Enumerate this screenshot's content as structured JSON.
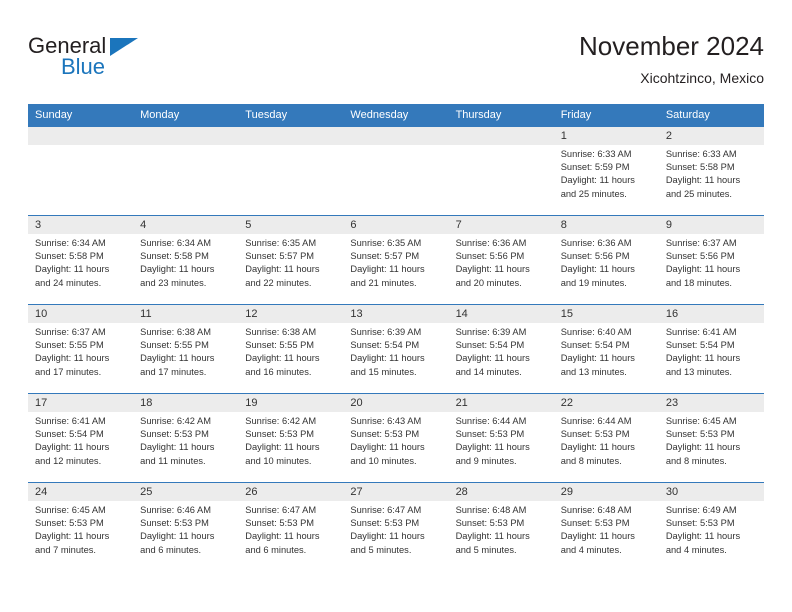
{
  "logo": {
    "word1": "General",
    "word2": "Blue",
    "triangle_icon": "blue-triangle-icon",
    "color_dark": "#231f20",
    "color_blue": "#1b75bc"
  },
  "header": {
    "title": "November 2024",
    "subtitle": "Xicohtzinco, Mexico"
  },
  "theme": {
    "header_bg": "#3479bb",
    "daynum_bg": "#ececec",
    "text": "#333333"
  },
  "calendar": {
    "weekday_headers": [
      "Sunday",
      "Monday",
      "Tuesday",
      "Wednesday",
      "Thursday",
      "Friday",
      "Saturday"
    ],
    "weeks": [
      [
        {
          "day": "",
          "sunrise": "",
          "sunset": "",
          "daylight": ""
        },
        {
          "day": "",
          "sunrise": "",
          "sunset": "",
          "daylight": ""
        },
        {
          "day": "",
          "sunrise": "",
          "sunset": "",
          "daylight": ""
        },
        {
          "day": "",
          "sunrise": "",
          "sunset": "",
          "daylight": ""
        },
        {
          "day": "",
          "sunrise": "",
          "sunset": "",
          "daylight": ""
        },
        {
          "day": "1",
          "sunrise": "Sunrise: 6:33 AM",
          "sunset": "Sunset: 5:59 PM",
          "daylight": "Daylight: 11 hours and 25 minutes."
        },
        {
          "day": "2",
          "sunrise": "Sunrise: 6:33 AM",
          "sunset": "Sunset: 5:58 PM",
          "daylight": "Daylight: 11 hours and 25 minutes."
        }
      ],
      [
        {
          "day": "3",
          "sunrise": "Sunrise: 6:34 AM",
          "sunset": "Sunset: 5:58 PM",
          "daylight": "Daylight: 11 hours and 24 minutes."
        },
        {
          "day": "4",
          "sunrise": "Sunrise: 6:34 AM",
          "sunset": "Sunset: 5:58 PM",
          "daylight": "Daylight: 11 hours and 23 minutes."
        },
        {
          "day": "5",
          "sunrise": "Sunrise: 6:35 AM",
          "sunset": "Sunset: 5:57 PM",
          "daylight": "Daylight: 11 hours and 22 minutes."
        },
        {
          "day": "6",
          "sunrise": "Sunrise: 6:35 AM",
          "sunset": "Sunset: 5:57 PM",
          "daylight": "Daylight: 11 hours and 21 minutes."
        },
        {
          "day": "7",
          "sunrise": "Sunrise: 6:36 AM",
          "sunset": "Sunset: 5:56 PM",
          "daylight": "Daylight: 11 hours and 20 minutes."
        },
        {
          "day": "8",
          "sunrise": "Sunrise: 6:36 AM",
          "sunset": "Sunset: 5:56 PM",
          "daylight": "Daylight: 11 hours and 19 minutes."
        },
        {
          "day": "9",
          "sunrise": "Sunrise: 6:37 AM",
          "sunset": "Sunset: 5:56 PM",
          "daylight": "Daylight: 11 hours and 18 minutes."
        }
      ],
      [
        {
          "day": "10",
          "sunrise": "Sunrise: 6:37 AM",
          "sunset": "Sunset: 5:55 PM",
          "daylight": "Daylight: 11 hours and 17 minutes."
        },
        {
          "day": "11",
          "sunrise": "Sunrise: 6:38 AM",
          "sunset": "Sunset: 5:55 PM",
          "daylight": "Daylight: 11 hours and 17 minutes."
        },
        {
          "day": "12",
          "sunrise": "Sunrise: 6:38 AM",
          "sunset": "Sunset: 5:55 PM",
          "daylight": "Daylight: 11 hours and 16 minutes."
        },
        {
          "day": "13",
          "sunrise": "Sunrise: 6:39 AM",
          "sunset": "Sunset: 5:54 PM",
          "daylight": "Daylight: 11 hours and 15 minutes."
        },
        {
          "day": "14",
          "sunrise": "Sunrise: 6:39 AM",
          "sunset": "Sunset: 5:54 PM",
          "daylight": "Daylight: 11 hours and 14 minutes."
        },
        {
          "day": "15",
          "sunrise": "Sunrise: 6:40 AM",
          "sunset": "Sunset: 5:54 PM",
          "daylight": "Daylight: 11 hours and 13 minutes."
        },
        {
          "day": "16",
          "sunrise": "Sunrise: 6:41 AM",
          "sunset": "Sunset: 5:54 PM",
          "daylight": "Daylight: 11 hours and 13 minutes."
        }
      ],
      [
        {
          "day": "17",
          "sunrise": "Sunrise: 6:41 AM",
          "sunset": "Sunset: 5:54 PM",
          "daylight": "Daylight: 11 hours and 12 minutes."
        },
        {
          "day": "18",
          "sunrise": "Sunrise: 6:42 AM",
          "sunset": "Sunset: 5:53 PM",
          "daylight": "Daylight: 11 hours and 11 minutes."
        },
        {
          "day": "19",
          "sunrise": "Sunrise: 6:42 AM",
          "sunset": "Sunset: 5:53 PM",
          "daylight": "Daylight: 11 hours and 10 minutes."
        },
        {
          "day": "20",
          "sunrise": "Sunrise: 6:43 AM",
          "sunset": "Sunset: 5:53 PM",
          "daylight": "Daylight: 11 hours and 10 minutes."
        },
        {
          "day": "21",
          "sunrise": "Sunrise: 6:44 AM",
          "sunset": "Sunset: 5:53 PM",
          "daylight": "Daylight: 11 hours and 9 minutes."
        },
        {
          "day": "22",
          "sunrise": "Sunrise: 6:44 AM",
          "sunset": "Sunset: 5:53 PM",
          "daylight": "Daylight: 11 hours and 8 minutes."
        },
        {
          "day": "23",
          "sunrise": "Sunrise: 6:45 AM",
          "sunset": "Sunset: 5:53 PM",
          "daylight": "Daylight: 11 hours and 8 minutes."
        }
      ],
      [
        {
          "day": "24",
          "sunrise": "Sunrise: 6:45 AM",
          "sunset": "Sunset: 5:53 PM",
          "daylight": "Daylight: 11 hours and 7 minutes."
        },
        {
          "day": "25",
          "sunrise": "Sunrise: 6:46 AM",
          "sunset": "Sunset: 5:53 PM",
          "daylight": "Daylight: 11 hours and 6 minutes."
        },
        {
          "day": "26",
          "sunrise": "Sunrise: 6:47 AM",
          "sunset": "Sunset: 5:53 PM",
          "daylight": "Daylight: 11 hours and 6 minutes."
        },
        {
          "day": "27",
          "sunrise": "Sunrise: 6:47 AM",
          "sunset": "Sunset: 5:53 PM",
          "daylight": "Daylight: 11 hours and 5 minutes."
        },
        {
          "day": "28",
          "sunrise": "Sunrise: 6:48 AM",
          "sunset": "Sunset: 5:53 PM",
          "daylight": "Daylight: 11 hours and 5 minutes."
        },
        {
          "day": "29",
          "sunrise": "Sunrise: 6:48 AM",
          "sunset": "Sunset: 5:53 PM",
          "daylight": "Daylight: 11 hours and 4 minutes."
        },
        {
          "day": "30",
          "sunrise": "Sunrise: 6:49 AM",
          "sunset": "Sunset: 5:53 PM",
          "daylight": "Daylight: 11 hours and 4 minutes."
        }
      ]
    ]
  }
}
